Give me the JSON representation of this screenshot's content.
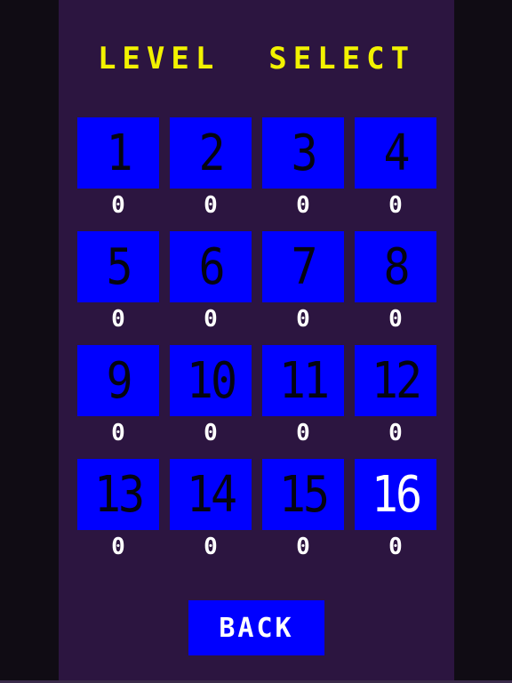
{
  "title": "LEVEL  SELECT",
  "colors": {
    "background": "#100c14",
    "panel": "#2c1540",
    "title": "#f2f200",
    "tile": "#0000ff",
    "tile_text": "#050510",
    "selected_text": "#ffffff",
    "score_text": "#ffffff"
  },
  "levels": [
    {
      "number": "1",
      "score": "0",
      "selected": false
    },
    {
      "number": "2",
      "score": "0",
      "selected": false
    },
    {
      "number": "3",
      "score": "0",
      "selected": false
    },
    {
      "number": "4",
      "score": "0",
      "selected": false
    },
    {
      "number": "5",
      "score": "0",
      "selected": false
    },
    {
      "number": "6",
      "score": "0",
      "selected": false
    },
    {
      "number": "7",
      "score": "0",
      "selected": false
    },
    {
      "number": "8",
      "score": "0",
      "selected": false
    },
    {
      "number": "9",
      "score": "0",
      "selected": false
    },
    {
      "number": "10",
      "score": "0",
      "selected": false
    },
    {
      "number": "11",
      "score": "0",
      "selected": false
    },
    {
      "number": "12",
      "score": "0",
      "selected": false
    },
    {
      "number": "13",
      "score": "0",
      "selected": false
    },
    {
      "number": "14",
      "score": "0",
      "selected": false
    },
    {
      "number": "15",
      "score": "0",
      "selected": false
    },
    {
      "number": "16",
      "score": "0",
      "selected": true
    }
  ],
  "back_label": "BACK"
}
